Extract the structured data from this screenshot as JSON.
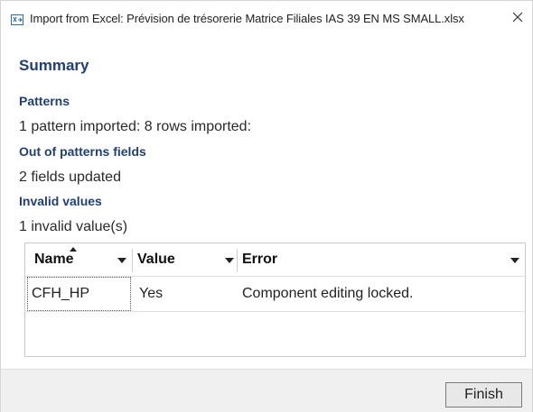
{
  "window": {
    "title": "Import from Excel: Prévision de trésorerie Matrice Filiales IAS 39 EN MS SMALL.xlsx",
    "icon": "excel-import-icon",
    "close_icon": "close-icon"
  },
  "summary": {
    "heading": "Summary",
    "patterns": {
      "heading": "Patterns",
      "text": "1 pattern imported: 8 rows imported:"
    },
    "out_of_patterns": {
      "heading": "Out of patterns fields",
      "text": "2 fields updated"
    },
    "invalid_values": {
      "heading": "Invalid values",
      "text": "1 invalid value(s)"
    }
  },
  "grid": {
    "columns": [
      {
        "label": "Name"
      },
      {
        "label": "Value"
      },
      {
        "label": "Error"
      }
    ],
    "rows": [
      {
        "name": "CFH_HP",
        "value": "Yes",
        "error": "Component editing locked."
      }
    ]
  },
  "footer": {
    "finish_label": "Finish"
  },
  "colors": {
    "heading": "#1f3f7a",
    "footer_bg": "#f0f0f0"
  }
}
